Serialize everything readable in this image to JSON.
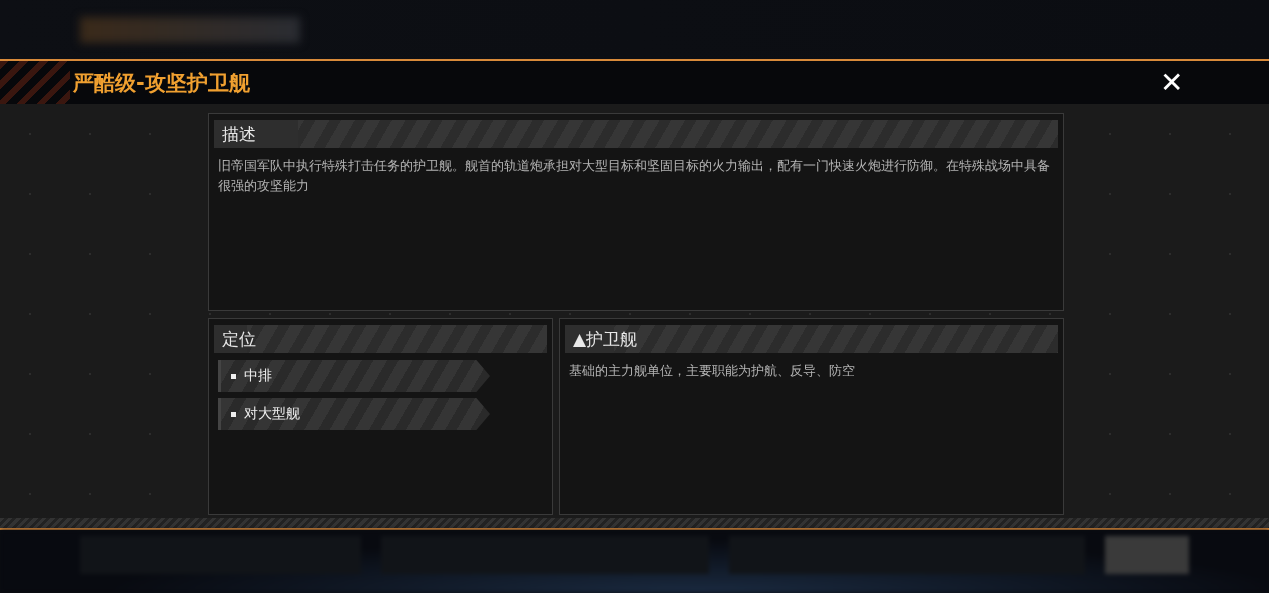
{
  "dialog": {
    "title": "严酷级-攻坚护卫舰",
    "close_label": "✕"
  },
  "description": {
    "heading": "描述",
    "text": "旧帝国军队中执行特殊打击任务的护卫舰。舰首的轨道炮承担对大型目标和坚固目标的火力输出，配有一门快速火炮进行防御。在特殊战场中具备很强的攻坚能力"
  },
  "positioning": {
    "heading": "定位",
    "tags": [
      {
        "label": "中排"
      },
      {
        "label": "对大型舰"
      }
    ]
  },
  "ship_class": {
    "heading": "▲护卫舰",
    "text": "基础的主力舰单位，主要职能为护航、反导、防空"
  }
}
